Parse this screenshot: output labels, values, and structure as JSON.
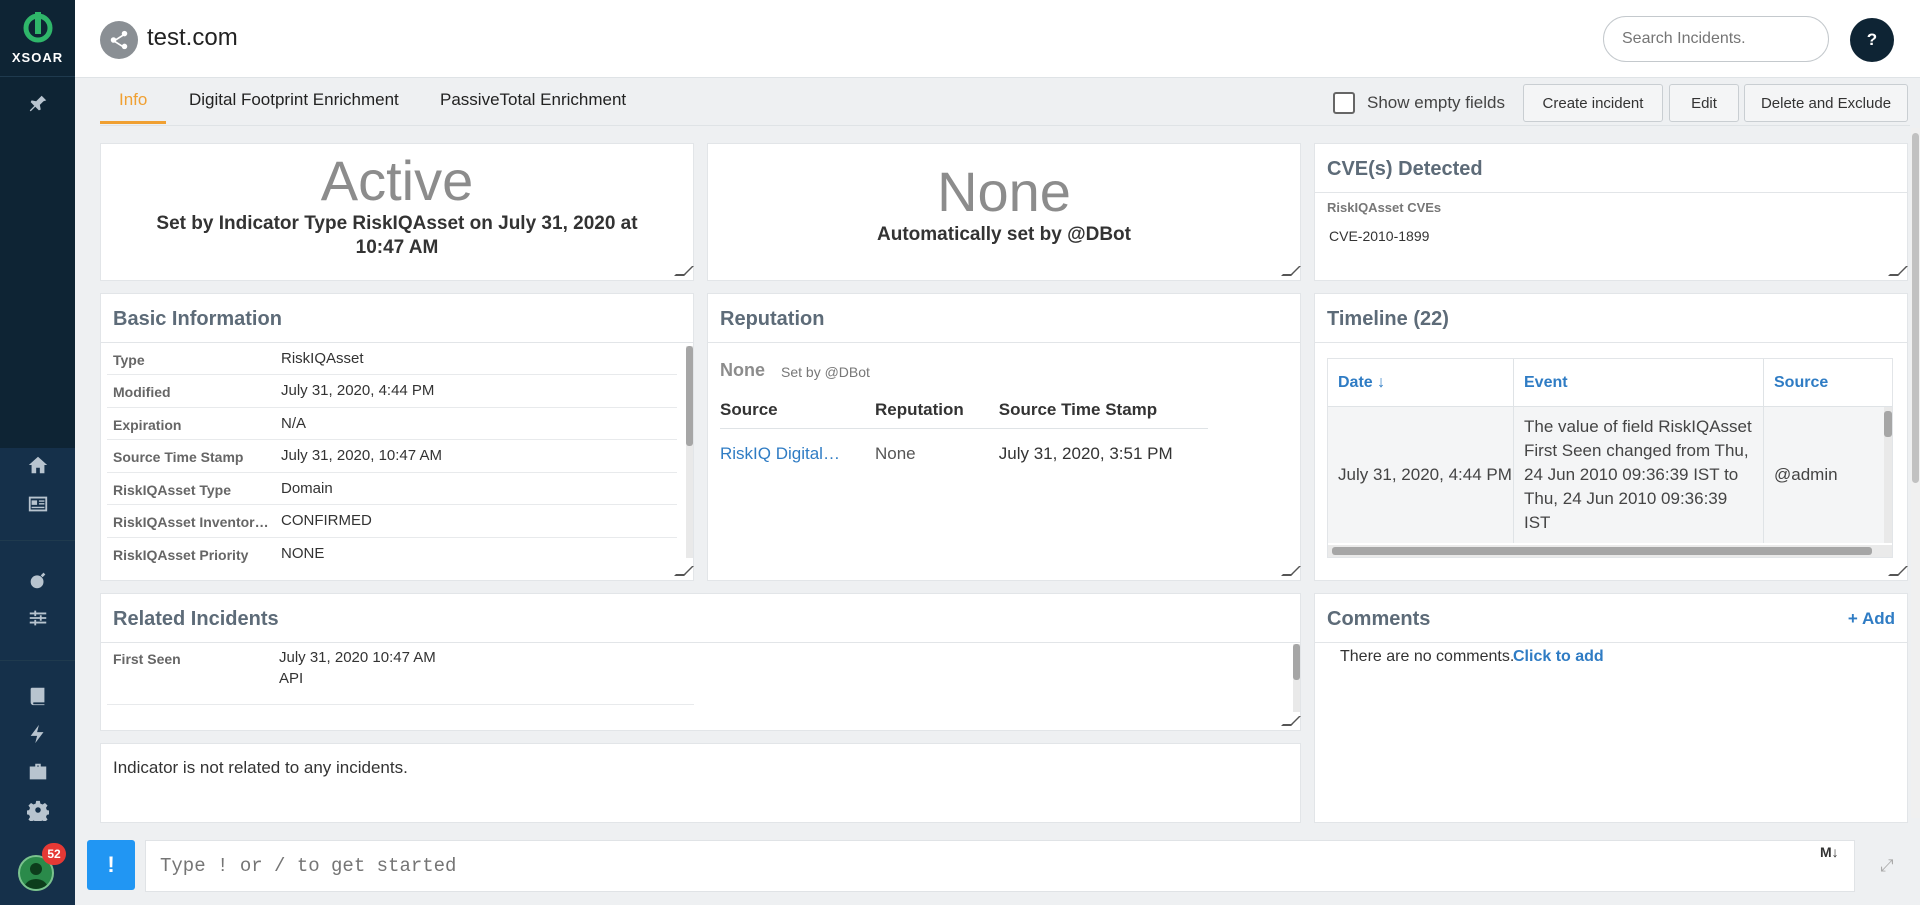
{
  "app": {
    "brand": "XSOAR",
    "notification_count": "52"
  },
  "header": {
    "title": "test.com",
    "search_placeholder": "Search Incidents.",
    "help_label": "?"
  },
  "tabs": [
    {
      "label": "Info",
      "active": true
    },
    {
      "label": "Digital Footprint Enrichment",
      "active": false
    },
    {
      "label": "PassiveTotal Enrichment",
      "active": false
    }
  ],
  "toolbar": {
    "show_empty_fields": "Show empty fields",
    "create_incident": "Create incident",
    "edit": "Edit",
    "delete_exclude": "Delete and Exclude"
  },
  "status": {
    "value": "Active",
    "set_by": "Set by Indicator Type RiskIQAsset on July 31, 2020 at",
    "set_time": "10:47 AM"
  },
  "verdict": {
    "value": "None",
    "set_by": "Automatically set by @DBot"
  },
  "cves": {
    "title": "CVE(s) Detected",
    "field_label": "RiskIQAsset CVEs",
    "value": "CVE-2010-1899"
  },
  "basic_info": {
    "title": "Basic Information",
    "rows": [
      {
        "label": "Type",
        "value": "RiskIQAsset"
      },
      {
        "label": "Modified",
        "value": "July 31, 2020, 4:44 PM"
      },
      {
        "label": "Expiration",
        "value": "N/A"
      },
      {
        "label": "Source Time Stamp",
        "value": "July 31, 2020, 10:47 AM"
      },
      {
        "label": "RiskIQAsset Type",
        "value": "Domain"
      },
      {
        "label": "RiskIQAsset Inventor…",
        "value": "CONFIRMED"
      },
      {
        "label": "RiskIQAsset Priority",
        "value": "NONE"
      }
    ]
  },
  "reputation": {
    "title": "Reputation",
    "value": "None",
    "set_by": "Set by @DBot",
    "columns": [
      "Source",
      "Reputation",
      "Source Time Stamp"
    ],
    "rows": [
      {
        "source": "RiskIQ Digital…",
        "reputation": "None",
        "timestamp": "July 31, 2020, 3:51 PM"
      }
    ]
  },
  "timeline": {
    "title": "Timeline (22)",
    "columns": [
      "Date ↓",
      "Event",
      "Source"
    ],
    "rows": [
      {
        "date": "July 31, 2020, 4:44 PM",
        "event": "The value of field RiskIQAsset First Seen changed from Thu, 24 Jun 2010 09:36:39 IST to Thu, 24 Jun 2010 09:36:39 IST",
        "source": "@admin"
      }
    ]
  },
  "related": {
    "title": "Related Incidents",
    "first_seen_label": "First Seen",
    "first_seen_value": "July 31, 2020 10:47 AM",
    "first_seen_source": "API",
    "empty_message": "Indicator is not related to any incidents."
  },
  "comments": {
    "title": "Comments",
    "add_label": "+ Add",
    "empty": "There are no comments.",
    "click_to_add": "Click to add"
  },
  "composer": {
    "placeholder": "Type ! or / to get started",
    "button": "!",
    "markdown": "M↓"
  }
}
